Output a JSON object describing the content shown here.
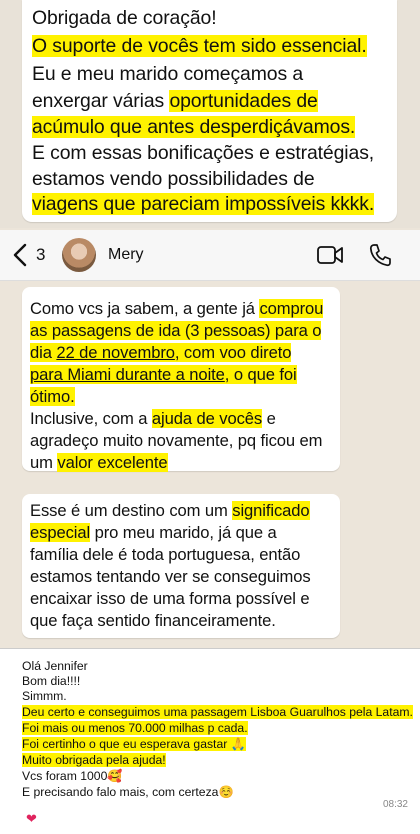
{
  "message1": {
    "lines": [
      "Obrigada de coração!",
      "O suporte de vocês tem sido essencial.",
      "Eu e meu marido começamos a",
      "enxergar várias ",
      "oportunidades de",
      "acúmulo que antes desperdiçávamos.",
      "E com essas bonificações e estratégias,",
      "estamos vendo possibilidades de",
      "viagens que pareciam impossíveis kkkk."
    ]
  },
  "chat_header": {
    "back_count": "3",
    "contact_name": "Mery",
    "icons": [
      "chevron-left-icon",
      "video-call-icon",
      "phone-icon"
    ]
  },
  "message2": {
    "l1a": "Como vcs ja sabem, a gente já ",
    "l1b": "comprou",
    "l2": "as passagens de ida (3 pessoas) para o",
    "l3a": "dia ",
    "l3b": "22 de novembro",
    "l3c": ", com voo direto",
    "l4a": "para Miami durante a noite",
    "l4b": ", o que foi",
    "l5": "ótimo.",
    "l6a": "Inclusive, com a ",
    "l6b": "ajuda de vocês",
    "l6c": " e",
    "l7": "agradeço muito novamente, pq ficou em",
    "l8a": "um ",
    "l8b": "valor excelente"
  },
  "message3": {
    "l1a": "Esse é um destino com um ",
    "l1b": "significado",
    "l2a": "especial",
    "l2b": " pro meu marido, já que a",
    "l3": "família dele é toda portuguesa, então",
    "l4": "estamos tentando ver se conseguimos",
    "l5": "encaixar isso de uma forma possível e",
    "l6": "que faça sentido financeiramente."
  },
  "message4": {
    "lines": [
      "Olá Jennifer",
      "Bom dia!!!!",
      "Simmm.",
      "Deu certo e conseguimos uma passagem Lisboa Guarulhos pela Latam.",
      "Foi mais ou menos 70.000 milhas p cada.",
      "Foi certinho o que eu esperava gastar 🙏",
      "Muito obrigada pela ajuda!",
      "Vcs foram 1000🥰",
      "E precisando falo mais, com certeza☺️"
    ],
    "time": "08:32",
    "reaction": "❤"
  },
  "colors": {
    "highlight": "#fff200",
    "chat_bg": "#ece5da",
    "bubble": "#ffffff"
  }
}
